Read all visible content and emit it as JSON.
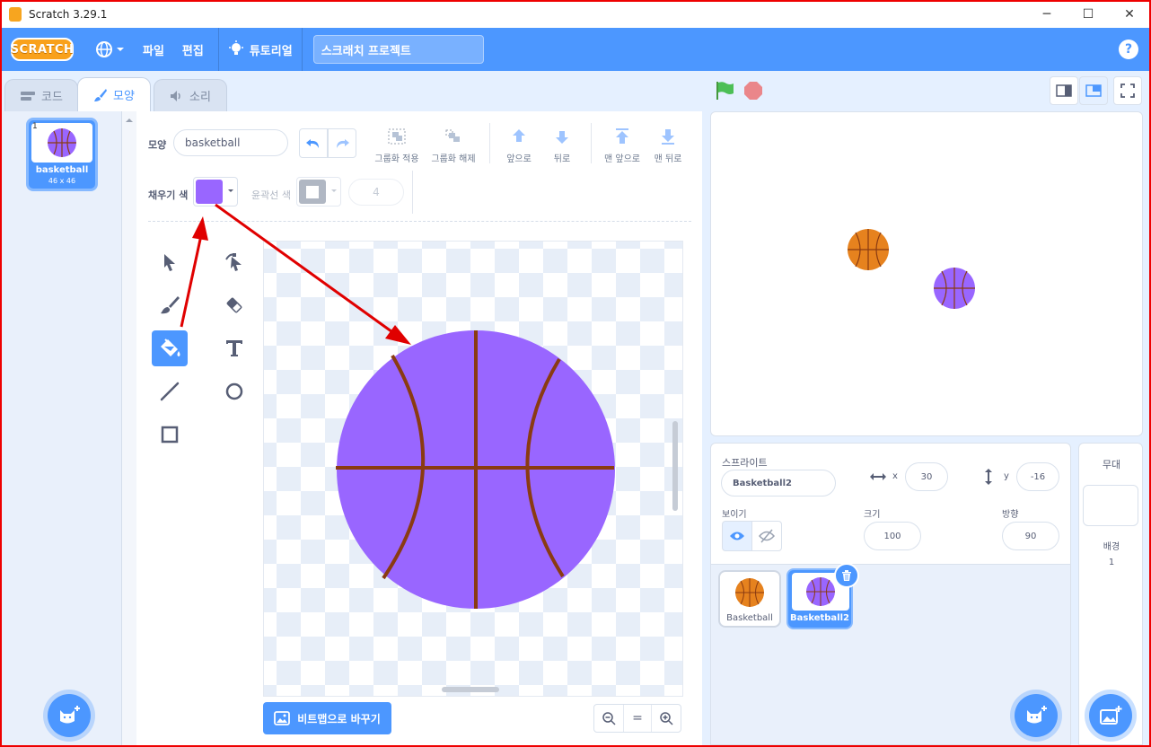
{
  "window": {
    "title": "Scratch 3.29.1",
    "minimize": "─",
    "maximize": "☐",
    "close": "✕"
  },
  "menubar": {
    "logo": "SCRATCH",
    "file": "파일",
    "edit": "편집",
    "tutorials": "튜토리얼",
    "project_title": "스크래치 프로젝트",
    "help": "?"
  },
  "tabs": {
    "code": "코드",
    "costumes": "모양",
    "sounds": "소리"
  },
  "costume_list": [
    {
      "number": "1",
      "name": "basketball",
      "size": "46 x 46"
    }
  ],
  "editor": {
    "costume_label": "모양",
    "costume_name": "basketball",
    "fill_label": "채우기 색",
    "outline_label": "윤곽선 색",
    "outline_width": "4",
    "fill_color": "#9966ff",
    "tools": {
      "group": "그룹화 적용",
      "ungroup": "그룹화 해제",
      "forward": "앞으로",
      "backward": "뒤로",
      "front": "맨 앞으로",
      "back": "맨 뒤로"
    },
    "bitmap_button": "비트맵으로 바꾸기",
    "zoom_reset": "="
  },
  "sprite_info": {
    "sprite_label": "스프라이트",
    "sprite_name": "Basketball2",
    "x_label": "x",
    "x": "30",
    "y_label": "y",
    "y": "-16",
    "show_label": "보이기",
    "size_label": "크기",
    "size": "100",
    "direction_label": "방향",
    "direction": "90"
  },
  "sprites": [
    {
      "name": "Basketball",
      "color": "#e6821e"
    },
    {
      "name": "Basketball2",
      "color": "#9966ff"
    }
  ],
  "stage_panel": {
    "title": "무대",
    "backdrops_label": "배경",
    "backdrops_count": "1"
  },
  "colors": {
    "accent": "#4c97ff",
    "annotation": "#e00000",
    "orange_ball": "#e6821e",
    "purple_ball": "#9966ff",
    "seam": "#8a3b12"
  }
}
